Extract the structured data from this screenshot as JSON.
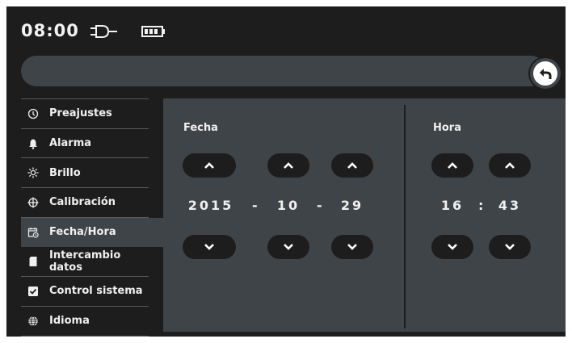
{
  "status_bar": {
    "time": "08:00",
    "plug_icon": "power-plug-icon",
    "battery_icon": "battery-full-icon"
  },
  "top_bar": {
    "back_icon": "back-arrow-icon"
  },
  "menu": {
    "items": [
      {
        "label": "Preajustes",
        "icon": "clock-icon"
      },
      {
        "label": "Alarma",
        "icon": "bell-icon"
      },
      {
        "label": "Brillo",
        "icon": "sun-icon"
      },
      {
        "label": "Calibración",
        "icon": "crosshair-icon"
      },
      {
        "label": "Fecha/Hora",
        "icon": "calendar-clock-icon",
        "active": true
      },
      {
        "label": "Intercambio datos",
        "icon": "sd-card-icon"
      },
      {
        "label": "Control sistema",
        "icon": "checkbox-icon"
      },
      {
        "label": "Idioma",
        "icon": "globe-icon"
      }
    ]
  },
  "panel": {
    "date": {
      "label": "Fecha",
      "year": "2015",
      "month": "10",
      "day": "29",
      "separator": "-"
    },
    "time": {
      "label": "Hora",
      "hour": "16",
      "minute": "43",
      "separator": ":"
    }
  },
  "colors": {
    "background": "#1d1d1d",
    "panel": "#3f4448",
    "button": "#1d1d1d",
    "text": "#f0f0f0"
  }
}
